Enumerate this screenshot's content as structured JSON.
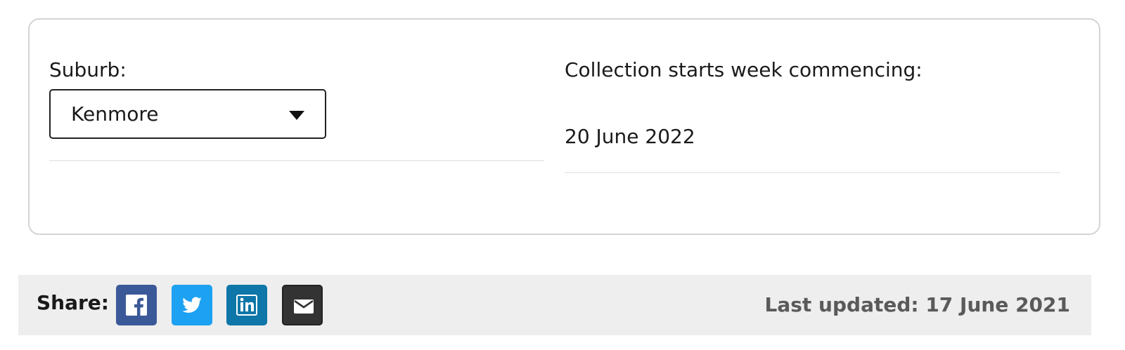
{
  "filter": {
    "suburb_label": "Suburb:",
    "suburb_selected": "Kenmore"
  },
  "collection": {
    "label": "Collection starts week commencing:",
    "date": "20 June 2022"
  },
  "share": {
    "label": "Share:",
    "buttons": [
      {
        "name": "facebook",
        "icon": "facebook-icon",
        "color": "#3b5998"
      },
      {
        "name": "twitter",
        "icon": "twitter-icon",
        "color": "#1da1f2"
      },
      {
        "name": "linkedin",
        "icon": "linkedin-icon",
        "color": "#0e76a8"
      },
      {
        "name": "email",
        "icon": "envelope-icon",
        "color": "#333333"
      }
    ]
  },
  "footer": {
    "last_updated": "Last updated: 17 June 2021"
  }
}
